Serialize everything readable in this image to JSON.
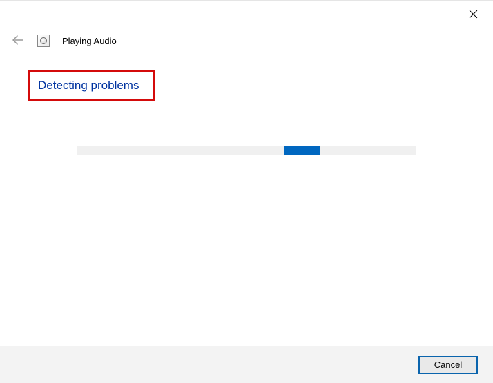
{
  "window": {
    "title": "Playing Audio"
  },
  "status": {
    "heading": "Detecting problems"
  },
  "buttons": {
    "cancel": "Cancel"
  },
  "icons": {
    "close": "close-icon",
    "back": "back-arrow-icon",
    "troubleshooter": "audio-troubleshooter-icon"
  },
  "highlight": {
    "color": "#d40b0b"
  },
  "progress": {
    "indeterminate": true
  }
}
